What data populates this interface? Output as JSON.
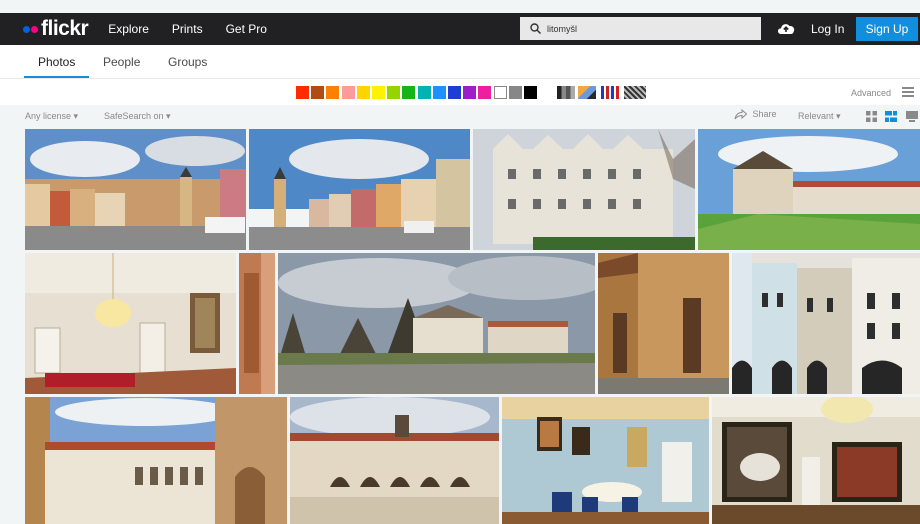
{
  "header": {
    "logo_text": "flickr",
    "nav": [
      "Explore",
      "Prints",
      "Get Pro"
    ],
    "search_value": "litomyšl",
    "login_label": "Log In",
    "signup_label": "Sign Up"
  },
  "tabs": [
    "Photos",
    "People",
    "Groups"
  ],
  "color_filters": [
    "#ff2a00",
    "#b24b16",
    "#ff7f00",
    "#ff9a9a",
    "#ffd400",
    "#fff200",
    "#96d400",
    "#16b416",
    "#00b3b3",
    "#1e90ff",
    "#1e3dd4",
    "#9b1ec8",
    "#ee1ea0",
    "#ffffff",
    "#878787",
    "#000000"
  ],
  "advanced_label": "Advanced",
  "filters": {
    "license_label": "Any license",
    "safesearch_label": "SafeSearch on",
    "share_label": "Share",
    "sort_label": "Relevant"
  }
}
